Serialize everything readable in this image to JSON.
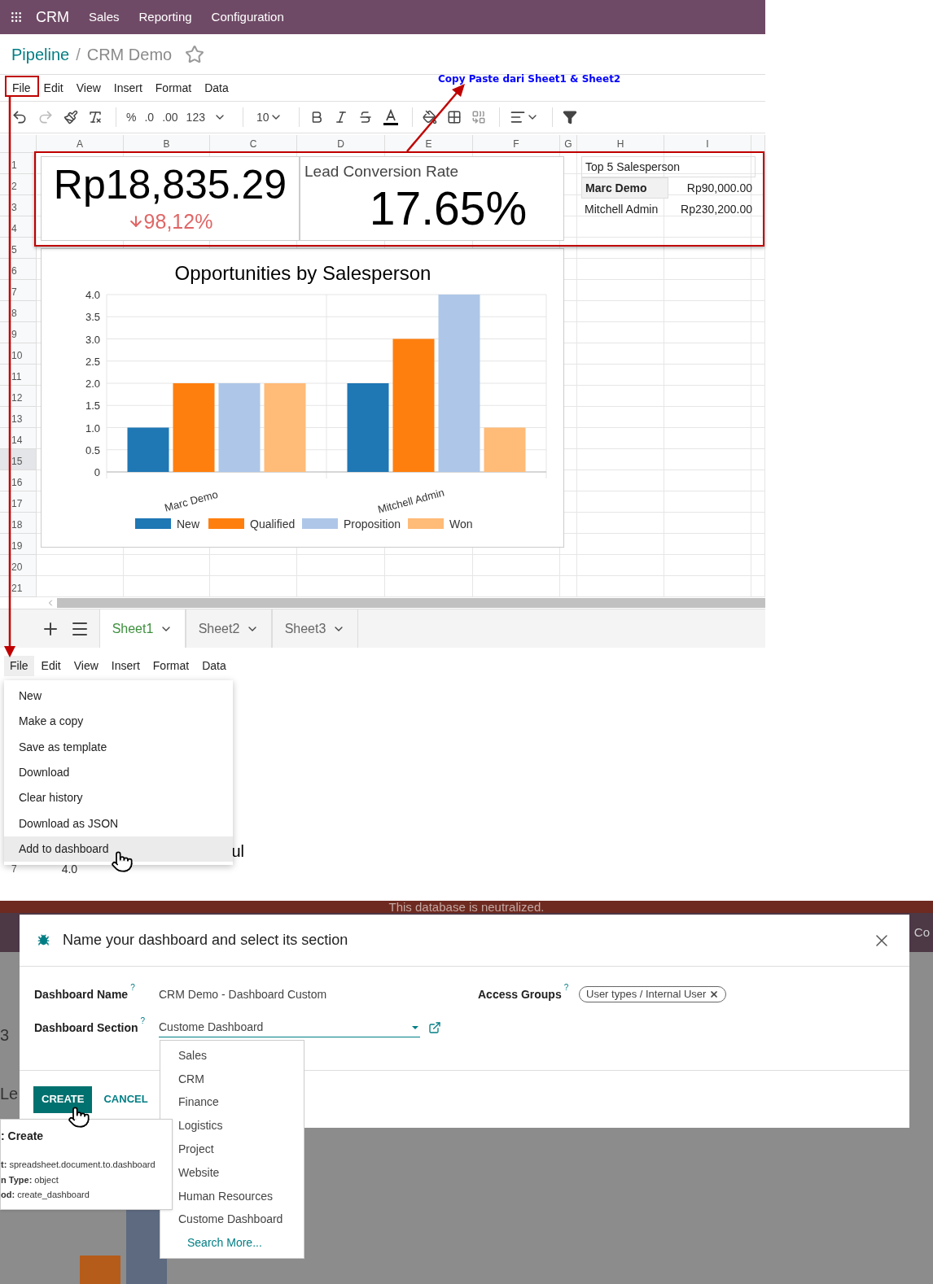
{
  "top_nav": {
    "app": "CRM",
    "menu": [
      "Sales",
      "Reporting",
      "Configuration"
    ]
  },
  "breadcrumb": {
    "parent": "Pipeline",
    "separator": "/",
    "current": "CRM Demo",
    "starred": false
  },
  "menubar": [
    "File",
    "Edit",
    "View",
    "Insert",
    "Format",
    "Data"
  ],
  "toolbar": {
    "format_buttons": [
      "%",
      ".0",
      ".00",
      "123"
    ],
    "font_size": "10"
  },
  "columns": [
    "A",
    "B",
    "C",
    "D",
    "E",
    "F",
    "G",
    "H",
    "I"
  ],
  "rows": [
    {
      "label": "1",
      "selected": false
    },
    {
      "label": "2",
      "selected": false
    },
    {
      "label": "3",
      "selected": false
    },
    {
      "label": "4",
      "selected": false
    },
    {
      "label": "5",
      "selected": false
    },
    {
      "label": "6",
      "selected": false
    },
    {
      "label": "7",
      "selected": false
    },
    {
      "label": "8",
      "selected": false
    },
    {
      "label": "9",
      "selected": false
    },
    {
      "label": "10",
      "selected": false
    },
    {
      "label": "11",
      "selected": false
    },
    {
      "label": "12",
      "selected": false
    },
    {
      "label": "13",
      "selected": false
    },
    {
      "label": "14",
      "selected": false
    },
    {
      "label": "15",
      "selected": true
    },
    {
      "label": "16",
      "selected": false
    },
    {
      "label": "17",
      "selected": false
    },
    {
      "label": "18",
      "selected": false
    },
    {
      "label": "19",
      "selected": false
    },
    {
      "label": "20",
      "selected": false
    },
    {
      "label": "21",
      "selected": false
    }
  ],
  "scorecard": {
    "value": "Rp18,835.29",
    "delta": "98,12%"
  },
  "kpi": {
    "title": "Lead Conversion Rate",
    "value": "17.65%"
  },
  "top_table": {
    "title": "Top 5 Salesperson",
    "rows": [
      {
        "name": "Marc Demo",
        "amount": "Rp90,000.00",
        "selected": true
      },
      {
        "name": "Mitchell Admin",
        "amount": "Rp230,200.00",
        "selected": false
      }
    ]
  },
  "chart_data": {
    "type": "bar",
    "title": "Opportunities by Salesperson",
    "categories": [
      "Marc Demo",
      "Mitchell Admin"
    ],
    "series": [
      {
        "name": "New",
        "color": "#1f77b4",
        "values": [
          1,
          2
        ]
      },
      {
        "name": "Qualified",
        "color": "#ff7f0e",
        "values": [
          2,
          3
        ]
      },
      {
        "name": "Proposition",
        "color": "#aec7e8",
        "values": [
          2,
          4
        ]
      },
      {
        "name": "Won",
        "color": "#ffbb78",
        "values": [
          2,
          1
        ]
      }
    ],
    "grid": true,
    "legend": "bottom",
    "ylim": [
      0,
      4
    ],
    "yticks": [
      0,
      0.5,
      {
        "value": 1,
        "label": "1.0"
      },
      1.5,
      {
        "value": 2,
        "label": "2.0"
      },
      2.5,
      {
        "value": 3,
        "label": "3.0"
      },
      3.5,
      {
        "value": 4,
        "label": "4.0"
      }
    ]
  },
  "sheets": [
    {
      "label": "Sheet1",
      "selected": true
    },
    {
      "label": "Sheet2",
      "selected": false
    },
    {
      "label": "Sheet3",
      "selected": false
    }
  ],
  "annotation": "Copy Paste dari Sheet1 & Sheet2",
  "file_menu": {
    "menubar": [
      "File",
      "Edit",
      "View",
      "Insert",
      "Format",
      "Data"
    ],
    "items": [
      {
        "label": "New",
        "selected": false
      },
      {
        "label": "Make a copy",
        "selected": false
      },
      {
        "label": "Save as template",
        "selected": false
      },
      {
        "label": "Download",
        "selected": false
      },
      {
        "label": "Clear history",
        "selected": false
      },
      {
        "label": "Download as JSON",
        "selected": false
      },
      {
        "label": "Add to dashboard",
        "selected": true
      }
    ],
    "row_label": "7",
    "tick_label": "4.0",
    "fragment": "ul"
  },
  "dialog": {
    "banner": "This database is neutralized.",
    "backdrop": [
      "Co",
      "3",
      "Le"
    ],
    "title": "Name your dashboard and select its section",
    "name_label": "Dashboard Name",
    "name_value": "CRM Demo - Dashboard Custom",
    "section_label": "Dashboard Section",
    "section_value": "Custome Dashboard",
    "groups_label": "Access Groups",
    "groups_tag": "User types / Internal User",
    "help": "?",
    "options": [
      {
        "label": "Sales",
        "kind": "option"
      },
      {
        "label": "CRM",
        "kind": "option"
      },
      {
        "label": "Finance",
        "kind": "option"
      },
      {
        "label": "Logistics",
        "kind": "option"
      },
      {
        "label": "Project",
        "kind": "option"
      },
      {
        "label": "Website",
        "kind": "option"
      },
      {
        "label": "Human Resources",
        "kind": "option"
      },
      {
        "label": "Custome Dashboard",
        "kind": "option"
      },
      {
        "label": "Search More...",
        "kind": "link"
      }
    ],
    "buttons": [
      "CREATE",
      "CANCEL"
    ],
    "tooltip": {
      "title": ": Create",
      "lines": [
        {
          "key": "t:",
          "value": "spreadsheet.document.to.dashboard"
        },
        {
          "key": "n Type:",
          "value": "object"
        },
        {
          "key": "od:",
          "value": "create_dashboard"
        }
      ]
    }
  }
}
